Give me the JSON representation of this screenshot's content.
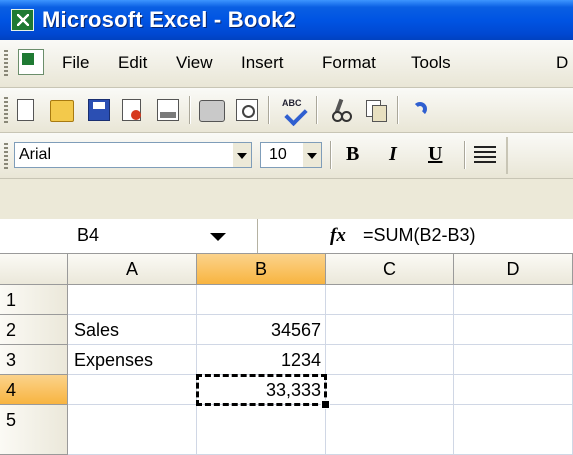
{
  "window": {
    "title": "Microsoft Excel - Book2"
  },
  "menubar": {
    "items": [
      "File",
      "Edit",
      "View",
      "Insert",
      "Format",
      "Tools",
      "D"
    ]
  },
  "toolbar": {
    "icons": [
      "new-icon",
      "open-icon",
      "save-icon",
      "permission-icon",
      "print-preview-icon",
      "print-icon",
      "preview-icon",
      "spelling-icon",
      "cut-icon",
      "copy-icon",
      "undo-icon"
    ]
  },
  "formatting": {
    "font": "Arial",
    "size": "10",
    "bold": "B",
    "italic": "I",
    "underline": "U"
  },
  "formula_bar": {
    "name_box": "B4",
    "fx": "fx",
    "formula": "=SUM(B2-B3)"
  },
  "sheet": {
    "columns": [
      "A",
      "B",
      "C",
      "D"
    ],
    "rows": [
      "1",
      "2",
      "3",
      "4",
      "5"
    ],
    "cells": {
      "A2": "Sales",
      "B2": "34567",
      "A3": "Expenses",
      "B3": "1234",
      "B4": "33,333"
    },
    "active_cell": "B4",
    "colors": {
      "active_header": "#f8b440",
      "gridline": "#d0d7e5",
      "title_bar": "#0054e3"
    }
  }
}
